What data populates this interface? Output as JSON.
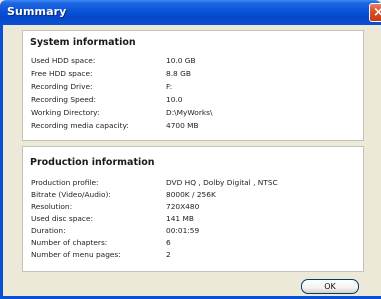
{
  "window": {
    "title": "Summary",
    "close_label": "×"
  },
  "system_info": {
    "heading": "System information",
    "rows": [
      {
        "label": "Used HDD space:",
        "value": "10.0  GB"
      },
      {
        "label": "Free HDD space:",
        "value": "8.8  GB"
      },
      {
        "label": "Recording Drive:",
        "value": "F:"
      },
      {
        "label": "Recording Speed:",
        "value": "10.0"
      },
      {
        "label": "Working Directory:",
        "value": "D:\\MyWorks\\"
      },
      {
        "label": "Recording media capacity:",
        "value": "4700 MB"
      }
    ]
  },
  "production_info": {
    "heading": "Production information",
    "rows": [
      {
        "label": "Production profile:",
        "value": "DVD HQ , Dolby Digital , NTSC"
      },
      {
        "label": "Bitrate (Video/Audio):",
        "value": "8000K / 256K"
      },
      {
        "label": "Resolution:",
        "value": "720X480"
      },
      {
        "label": "Used disc space:",
        "value": "141 MB"
      },
      {
        "label": "Duration:",
        "value": "00:01:59"
      },
      {
        "label": "Number of chapters:",
        "value": "6"
      },
      {
        "label": "Number of menu pages:",
        "value": "2"
      }
    ]
  },
  "buttons": {
    "ok_label": "OK"
  }
}
